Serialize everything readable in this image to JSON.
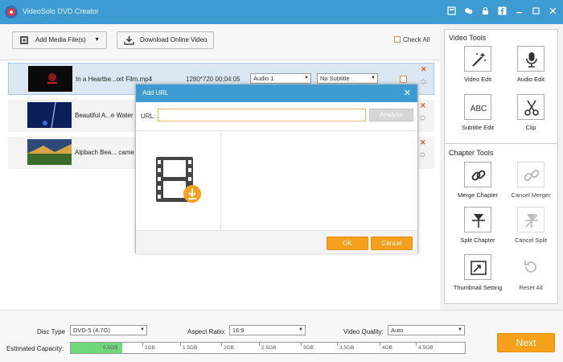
{
  "app": {
    "title": "VideoSolo DVD Creator"
  },
  "toolbar": {
    "add_media": "Add Media File(s)",
    "download_online": "Download Online Video",
    "check_all": "Check All"
  },
  "media": [
    {
      "name": "In a Heartbe...ort Film.mp4",
      "resolution_duration": "1280*720  00:04:05",
      "audio": "Audio 1",
      "subtitle": "No Subtitle"
    },
    {
      "name": "Beautiful A...e Water"
    },
    {
      "name": "Alpbach Bea... came"
    }
  ],
  "dialog": {
    "title": "Add URL",
    "url_label": "URL:",
    "url_value": "",
    "analyze": "Analyze",
    "ok": "OK",
    "cancel": "Cancel"
  },
  "video_tools": {
    "title": "Video Tools",
    "items": [
      {
        "label": "Video Edit",
        "icon": "magic-wand-icon"
      },
      {
        "label": "Audio Edit",
        "icon": "microphone-icon"
      },
      {
        "label": "Subtitle Edit",
        "icon": "abc-text-icon"
      },
      {
        "label": "Clip",
        "icon": "scissors-icon"
      }
    ]
  },
  "chapter_tools": {
    "title": "Chapter Tools",
    "items": [
      {
        "label": "Merge Chapter",
        "icon": "link-icon",
        "enabled": true
      },
      {
        "label": "Cancel Merger",
        "icon": "unlink-icon",
        "enabled": false
      },
      {
        "label": "Split Chapter",
        "icon": "split-icon",
        "enabled": true
      },
      {
        "label": "Cancel Split",
        "icon": "cancel-split-icon",
        "enabled": false
      },
      {
        "label": "Thumbnail Setting",
        "icon": "thumbnail-icon",
        "enabled": true
      },
      {
        "label": "Reset All",
        "icon": "reset-icon",
        "enabled": false
      }
    ]
  },
  "bottom": {
    "disc_type_label": "Disc Type",
    "disc_type": "DVD-5 (4.7G)",
    "aspect_label": "Aspect Ratio:",
    "aspect": "16:9",
    "quality_label": "Video Quality:",
    "quality": "Auto",
    "capacity_label": "Estimated Capacity:",
    "capacity_used_fraction": 0.13,
    "ticks": [
      "0.5GB",
      "1GB",
      "1.5GB",
      "2GB",
      "2.5GB",
      "3GB",
      "3.5GB",
      "4GB",
      "4.5GB"
    ],
    "next": "Next"
  },
  "colors": {
    "titlebar": "#3d9bd1",
    "accent": "#f7a01c",
    "capacity": "#6ed87a",
    "remove": "#e05a2c"
  }
}
